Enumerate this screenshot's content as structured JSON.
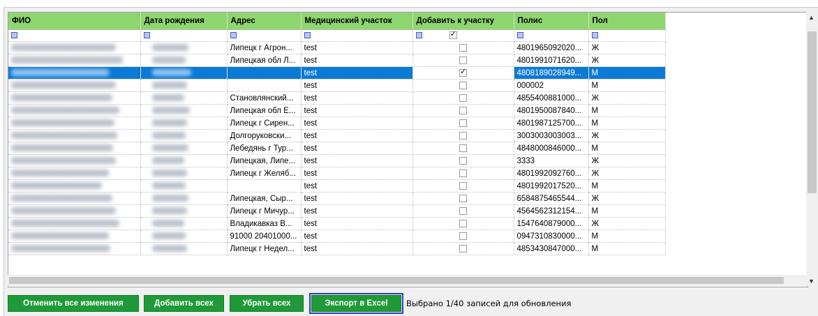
{
  "columns": [
    "ФИО",
    "Дата рождения",
    "Адрес",
    "Медицинский участок",
    "Добавить к участку",
    "Полис",
    "Пол"
  ],
  "rows": [
    {
      "address": "Липецк г Агрон...",
      "area": "test",
      "checked": false,
      "policy": "4801965092020...",
      "sex": "Ж"
    },
    {
      "address": "Липецкая обл Л...",
      "area": "test",
      "checked": false,
      "policy": "4801991071620...",
      "sex": "Ж"
    },
    {
      "address": "",
      "area": "test",
      "checked": true,
      "policy": "4808189028949...",
      "sex": "М",
      "selected": true
    },
    {
      "address": "",
      "area": "test",
      "checked": false,
      "policy": "000002",
      "sex": "М"
    },
    {
      "address": "Становлянский...",
      "area": "test",
      "checked": false,
      "policy": "4855400881000...",
      "sex": "Ж"
    },
    {
      "address": "Липецкая обл Е...",
      "area": "test",
      "checked": false,
      "policy": "4801950087840...",
      "sex": "М"
    },
    {
      "address": "Липецк г Сирен...",
      "area": "test",
      "checked": false,
      "policy": "4801987125700...",
      "sex": "М"
    },
    {
      "address": "Долгоруковски...",
      "area": "test",
      "checked": false,
      "policy": "3003003003003...",
      "sex": "Ж"
    },
    {
      "address": "Лебедянь г Тур...",
      "area": "test",
      "checked": false,
      "policy": "4848000846000...",
      "sex": "М"
    },
    {
      "address": "Липецкая, Липе...",
      "area": "test",
      "checked": false,
      "policy": "3333",
      "sex": "Ж"
    },
    {
      "address": "Липецк г Желяб...",
      "area": "test",
      "checked": false,
      "policy": "4801992092760...",
      "sex": "Ж"
    },
    {
      "address": "",
      "area": "test",
      "checked": false,
      "policy": "4801992017520...",
      "sex": "М"
    },
    {
      "address": "Липецкая, Сыр...",
      "area": "test",
      "checked": false,
      "policy": "6584875465544...",
      "sex": "Ж"
    },
    {
      "address": "Липецк г Мичур...",
      "area": "test",
      "checked": false,
      "policy": "4564562312154...",
      "sex": "М"
    },
    {
      "address": "Владикавказ В...",
      "area": "test",
      "checked": false,
      "policy": "1547640879000...",
      "sex": "Ж"
    },
    {
      "address": "91000 20401000...",
      "area": "test",
      "checked": false,
      "policy": "0947310830000...",
      "sex": "М"
    },
    {
      "address": "Липецк г Недел...",
      "area": "test",
      "checked": false,
      "policy": "4853430847000...",
      "sex": "М"
    }
  ],
  "buttons": {
    "cancel": "Отменить все изменения",
    "add_all": "Добавить всех",
    "remove_all": "Убрать всех",
    "export": "Экспорт в Excel"
  },
  "status": "Выбрано 1/40 записей для обновления",
  "colors": {
    "header": "#8ed66f",
    "button": "#1f9a38",
    "selection": "#0a7ad6"
  }
}
